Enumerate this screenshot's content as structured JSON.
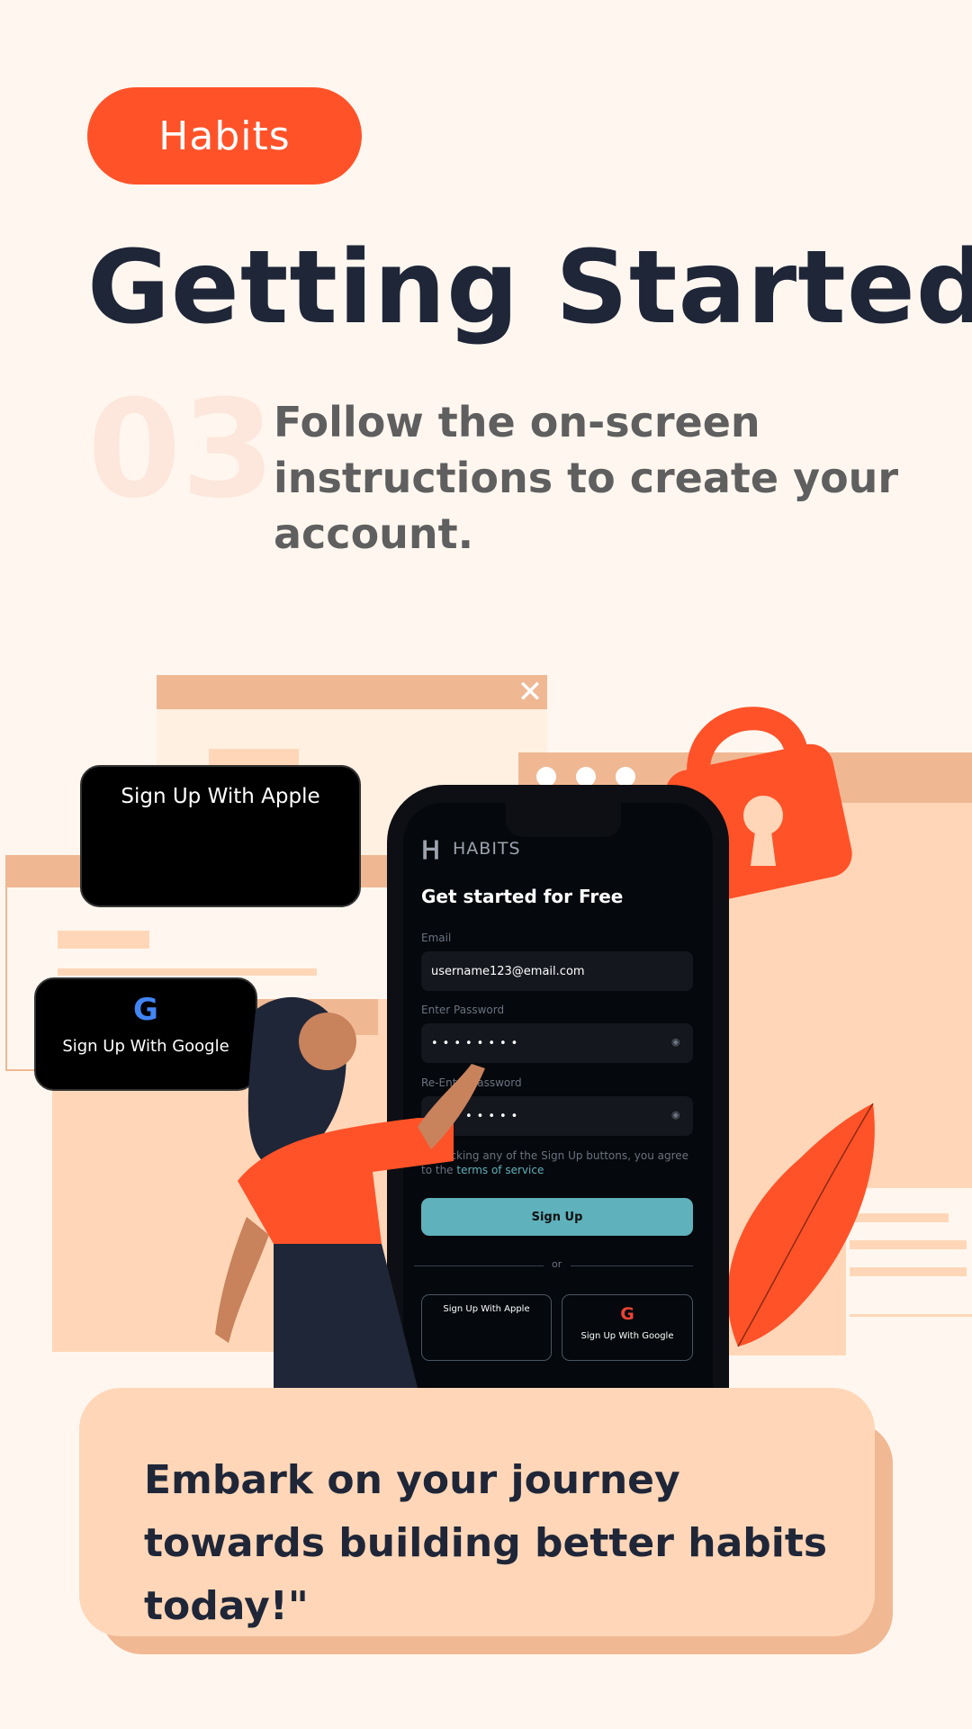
{
  "brand": {
    "logo": "Habits"
  },
  "page_title": "Getting Started",
  "step": {
    "number": "03",
    "text": "Follow the on-screen instructions to create your account."
  },
  "floating_buttons": {
    "apple": "Sign Up With Apple",
    "google": "Sign Up With Google"
  },
  "phone": {
    "brand": "HABITS",
    "heading": "Get started for Free",
    "email_label": "Email",
    "email_value": "username123@email.com",
    "password_label": "Enter Password",
    "password_value": "••••••••",
    "reenter_label": "Re-Enter Password",
    "reenter_value": "••••••••",
    "consent_text": "By clicking any of the Sign Up buttons, you agree to the",
    "terms_link": "terms of service",
    "signup_button": "Sign Up",
    "divider": "or",
    "apple_button": "Sign Up With Apple",
    "google_button": "Sign Up With Google"
  },
  "tagline": "Embark on your journey towards building better habits today!\"",
  "colors": {
    "background": "#fff7ef",
    "brand_orange": "#ff5229",
    "teal": "#5fb1bb",
    "navy": "#1f2638",
    "card": "#ffd7b8"
  }
}
